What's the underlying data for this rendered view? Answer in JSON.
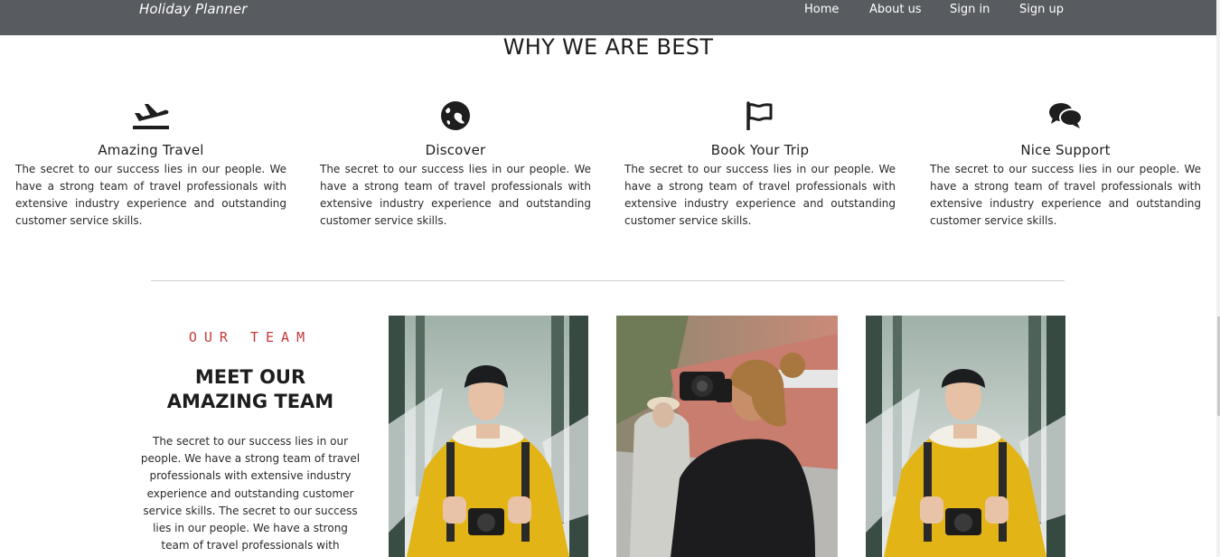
{
  "navbar": {
    "brand": "Holiday Planner",
    "links": [
      "Home",
      "About us",
      "Sign in",
      "Sign up"
    ]
  },
  "why": {
    "title": "WHY WE ARE BEST",
    "features": [
      {
        "icon": "plane-departure-icon",
        "title": "Amazing Travel",
        "text": "The secret to our success lies in our people. We have a strong team of travel professionals with extensive industry experience and outstanding customer service skills."
      },
      {
        "icon": "globe-icon",
        "title": "Discover",
        "text": "The secret to our success lies in our people. We have a strong team of travel professionals with extensive industry experience and outstanding customer service skills."
      },
      {
        "icon": "flag-icon",
        "title": "Book Your Trip",
        "text": "The secret to our success lies in our people. We have a strong team of travel professionals with extensive industry experience and outstanding customer service skills."
      },
      {
        "icon": "comments-icon",
        "title": "Nice Support",
        "text": "The secret to our success lies in our people. We have a strong team of travel professionals with extensive industry experience and outstanding customer service skills."
      }
    ]
  },
  "team": {
    "kicker": "OUR TEAM",
    "title": "MEET OUR AMAZING TEAM",
    "text": "The secret to our success lies in our people. We have a strong team of travel professionals with extensive industry experience and outstanding customer service skills. The secret to our success lies in our people. We have a strong team of travel professionals with extensive industry",
    "photos": [
      "man-yellow-jacket-photo",
      "woman-camera-photo",
      "man-yellow-jacket-photo"
    ]
  },
  "colors": {
    "navbar": "#585c60",
    "accent": "#c43a3a",
    "text": "#222222"
  }
}
